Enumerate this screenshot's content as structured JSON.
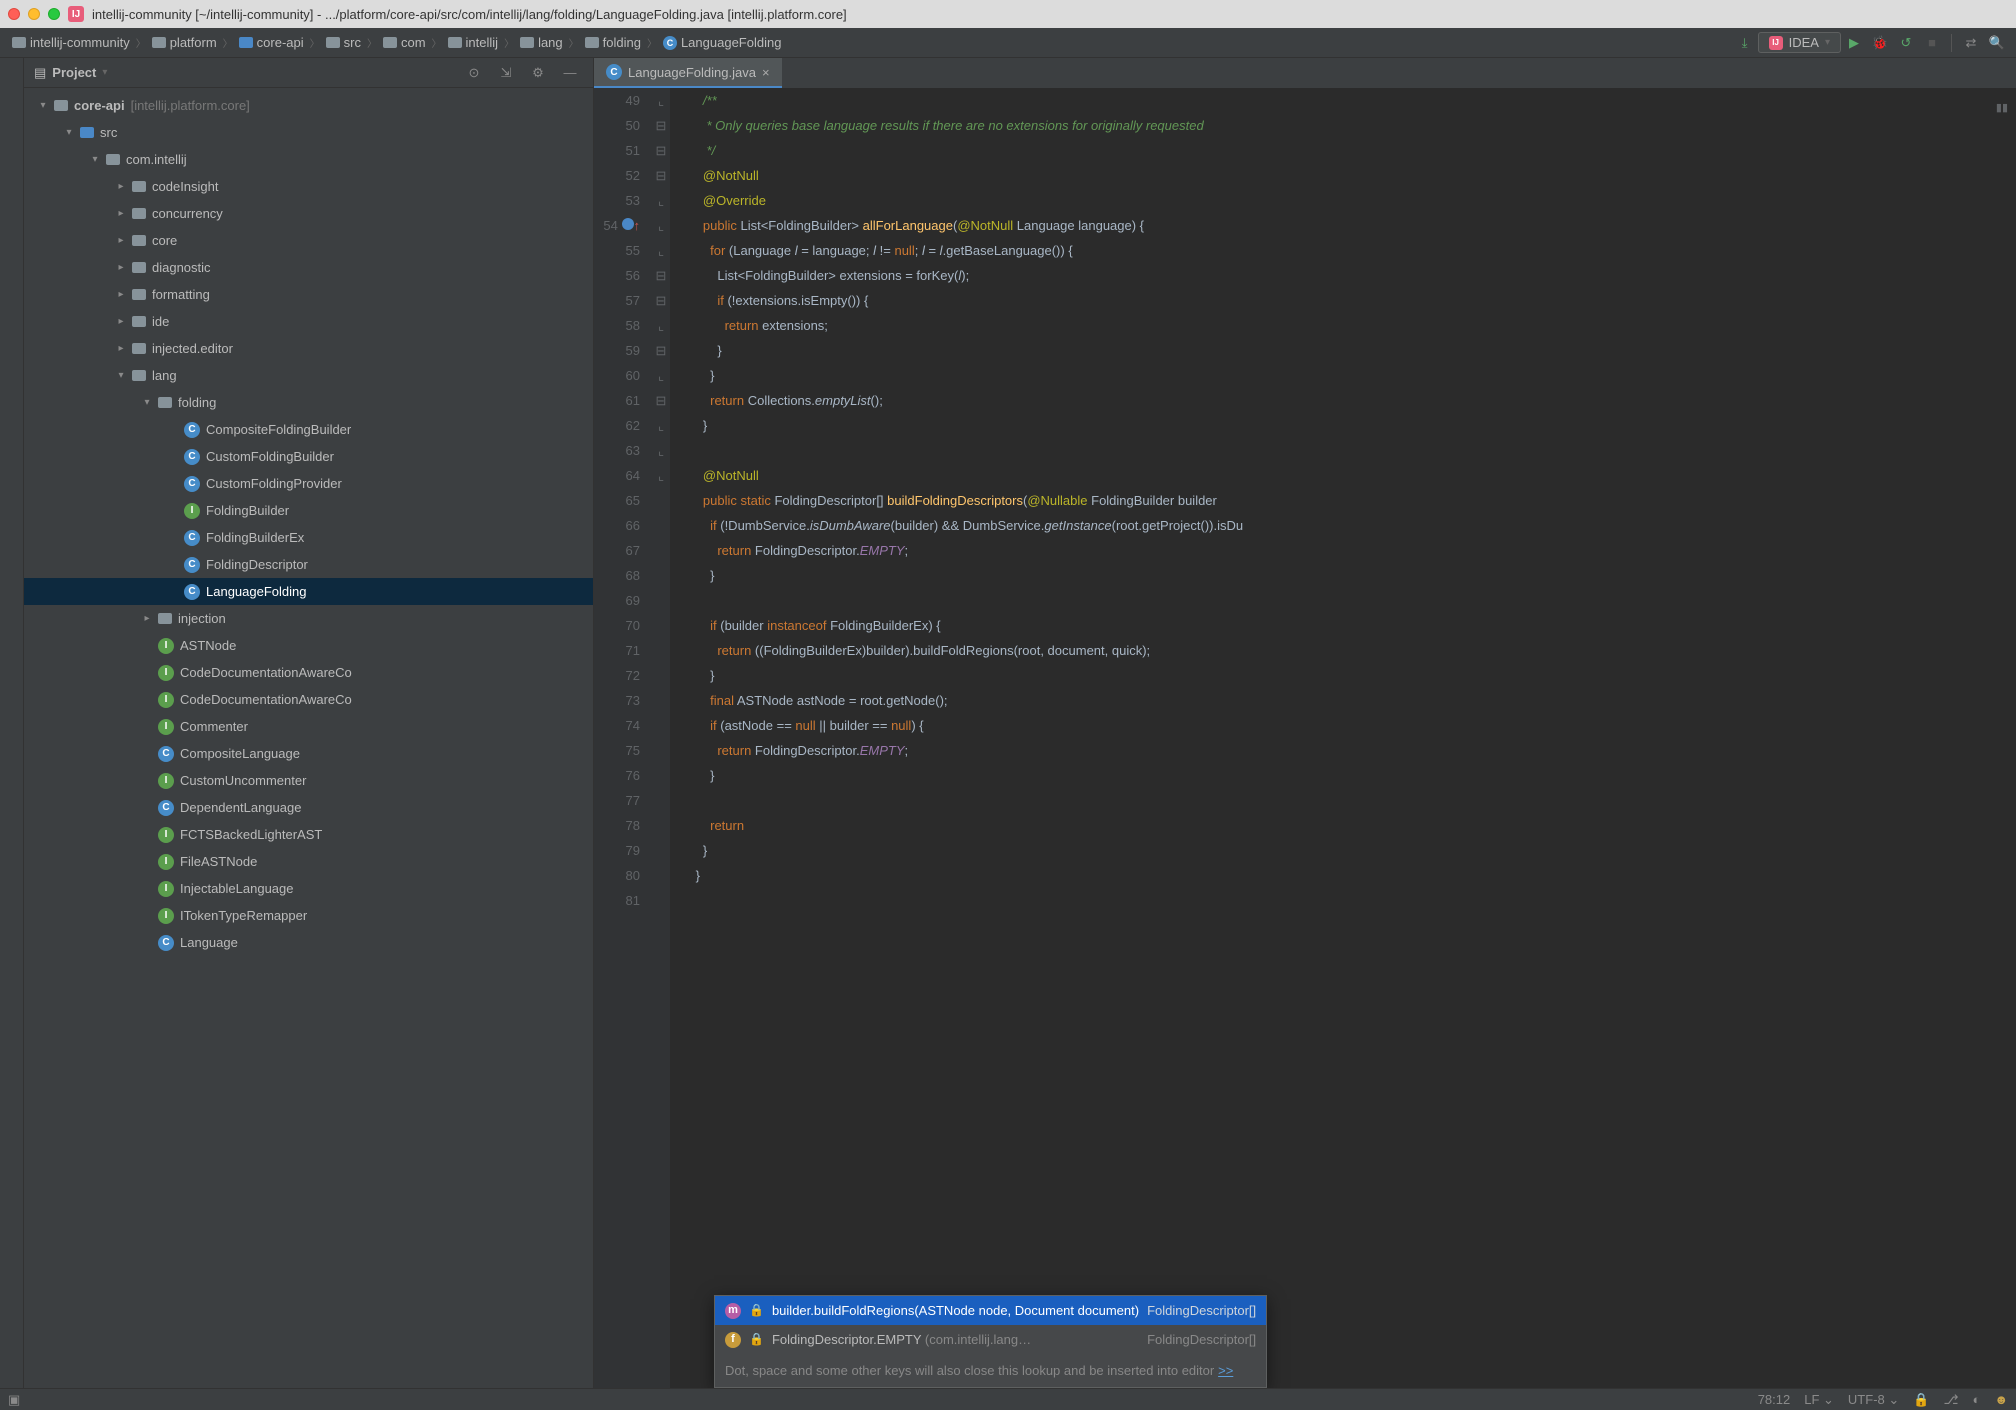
{
  "window": {
    "title": "intellij-community [~/intellij-community] - .../platform/core-api/src/com/intellij/lang/folding/LanguageFolding.java [intellij.platform.core]"
  },
  "breadcrumbs": [
    "intellij-community",
    "platform",
    "core-api",
    "src",
    "com",
    "intellij",
    "lang",
    "folding",
    "LanguageFolding"
  ],
  "run_config": "IDEA",
  "project": {
    "title": "Project",
    "tree": [
      {
        "d": 0,
        "a": "v",
        "i": "fold",
        "t": "core-api",
        "suffix": "[intellij.platform.core]",
        "bold": true
      },
      {
        "d": 1,
        "a": "v",
        "i": "fold-blue",
        "t": "src"
      },
      {
        "d": 2,
        "a": "v",
        "i": "fold",
        "t": "com.intellij"
      },
      {
        "d": 3,
        "a": ">",
        "i": "fold",
        "t": "codeInsight"
      },
      {
        "d": 3,
        "a": ">",
        "i": "fold",
        "t": "concurrency"
      },
      {
        "d": 3,
        "a": ">",
        "i": "fold",
        "t": "core"
      },
      {
        "d": 3,
        "a": ">",
        "i": "fold",
        "t": "diagnostic"
      },
      {
        "d": 3,
        "a": ">",
        "i": "fold",
        "t": "formatting"
      },
      {
        "d": 3,
        "a": ">",
        "i": "fold",
        "t": "ide"
      },
      {
        "d": 3,
        "a": ">",
        "i": "fold",
        "t": "injected.editor"
      },
      {
        "d": 3,
        "a": "v",
        "i": "fold",
        "t": "lang"
      },
      {
        "d": 4,
        "a": "v",
        "i": "fold",
        "t": "folding"
      },
      {
        "d": 5,
        "a": "",
        "i": "c",
        "t": "CompositeFoldingBuilder"
      },
      {
        "d": 5,
        "a": "",
        "i": "c",
        "t": "CustomFoldingBuilder"
      },
      {
        "d": 5,
        "a": "",
        "i": "c",
        "t": "CustomFoldingProvider"
      },
      {
        "d": 5,
        "a": "",
        "i": "i",
        "t": "FoldingBuilder"
      },
      {
        "d": 5,
        "a": "",
        "i": "c",
        "t": "FoldingBuilderEx"
      },
      {
        "d": 5,
        "a": "",
        "i": "c",
        "t": "FoldingDescriptor"
      },
      {
        "d": 5,
        "a": "",
        "i": "c",
        "t": "LanguageFolding",
        "sel": true
      },
      {
        "d": 4,
        "a": ">",
        "i": "fold",
        "t": "injection"
      },
      {
        "d": 4,
        "a": "",
        "i": "i",
        "t": "ASTNode"
      },
      {
        "d": 4,
        "a": "",
        "i": "i",
        "t": "CodeDocumentationAwareCo"
      },
      {
        "d": 4,
        "a": "",
        "i": "i",
        "t": "CodeDocumentationAwareCo"
      },
      {
        "d": 4,
        "a": "",
        "i": "i",
        "t": "Commenter"
      },
      {
        "d": 4,
        "a": "",
        "i": "c",
        "t": "CompositeLanguage"
      },
      {
        "d": 4,
        "a": "",
        "i": "i",
        "t": "CustomUncommenter"
      },
      {
        "d": 4,
        "a": "",
        "i": "c",
        "t": "DependentLanguage"
      },
      {
        "d": 4,
        "a": "",
        "i": "i",
        "t": "FCTSBackedLighterAST"
      },
      {
        "d": 4,
        "a": "",
        "i": "i",
        "t": "FileASTNode"
      },
      {
        "d": 4,
        "a": "",
        "i": "i",
        "t": "InjectableLanguage"
      },
      {
        "d": 4,
        "a": "",
        "i": "i",
        "t": "ITokenTypeRemapper"
      },
      {
        "d": 4,
        "a": "",
        "i": "c",
        "t": "Language"
      }
    ]
  },
  "tab": {
    "name": "LanguageFolding.java"
  },
  "lines_start": 49,
  "code": [
    {
      "n": 49,
      "f": "",
      "h": "        <span class='cmt'>/**</span>"
    },
    {
      "n": 50,
      "f": "",
      "h": "<span class='cmt'>         * Only queries base language results if there are no extensions for originally requested</span>"
    },
    {
      "n": 51,
      "f": "]",
      "h": "<span class='cmt'>         */</span>"
    },
    {
      "n": 52,
      "f": "",
      "h": "        <span class='ann'>@NotNull</span>"
    },
    {
      "n": 53,
      "f": "",
      "h": "        <span class='ann'>@Override</span>"
    },
    {
      "n": 54,
      "f": "[",
      "g": "o",
      "h": "        <span class='kw'>public</span> List&lt;FoldingBuilder&gt; <span class='fn'>allForLanguage</span>(<span class='ann'>@NotNull</span> Language <span class='par'>language</span>) {"
    },
    {
      "n": 55,
      "f": "[",
      "h": "          <span class='kw'>for</span> (Language <span class='l'>l</span> = language; <span class='l'>l</span> != <span class='kw'>null</span>; <span class='l'>l</span> = <span class='l'>l</span>.getBaseLanguage()) {"
    },
    {
      "n": 56,
      "f": "",
      "h": "            List&lt;FoldingBuilder&gt; extensions = forKey(<span class='l'>l</span>);"
    },
    {
      "n": 57,
      "f": "[",
      "h": "            <span class='kw'>if</span> (!extensions.isEmpty()) {"
    },
    {
      "n": 58,
      "f": "",
      "h": "              <span class='kw'>return</span> extensions;"
    },
    {
      "n": 59,
      "f": "]",
      "h": "            }"
    },
    {
      "n": 60,
      "f": "]",
      "h": "          }"
    },
    {
      "n": 61,
      "f": "",
      "h": "          <span class='kw'>return</span> Collections.<span class='it'>emptyList</span>();"
    },
    {
      "n": 62,
      "f": "]",
      "h": "        }"
    },
    {
      "n": 63,
      "f": "",
      "h": ""
    },
    {
      "n": 64,
      "f": "",
      "h": "        <span class='ann'>@NotNull</span>"
    },
    {
      "n": 65,
      "f": "[",
      "h": "        <span class='kw'>public static</span> FoldingDescriptor[] <span class='fn'>buildFoldingDescriptors</span>(<span class='ann'>@Nullable</span> FoldingBuilder <span class='par'>builder</span>"
    },
    {
      "n": 66,
      "f": "[",
      "h": "          <span class='kw'>if</span> (!DumbService.<span class='it'>isDumbAware</span>(builder) &amp;&amp; DumbService.<span class='it'>getInstance</span>(root.getProject()).isDu"
    },
    {
      "n": 67,
      "f": "",
      "h": "            <span class='kw'>return</span> FoldingDescriptor.<span class='it pur'>EMPTY</span>;"
    },
    {
      "n": 68,
      "f": "]",
      "h": "          }"
    },
    {
      "n": 69,
      "f": "",
      "h": ""
    },
    {
      "n": 70,
      "f": "[",
      "h": "          <span class='kw'>if</span> (builder <span class='kw'>instanceof</span> FoldingBuilderEx) {"
    },
    {
      "n": 71,
      "f": "",
      "h": "            <span class='kw'>return</span> ((FoldingBuilderEx)builder).buildFoldRegions(root, document, quick);"
    },
    {
      "n": 72,
      "f": "]",
      "h": "          }"
    },
    {
      "n": 73,
      "f": "",
      "h": "          <span class='kw'>final</span> ASTNode astNode = root.getNode();"
    },
    {
      "n": 74,
      "f": "[",
      "h": "          <span class='kw'>if</span> (astNode == <span class='kw'>null</span> || builder == <span class='kw'>null</span>) {"
    },
    {
      "n": 75,
      "f": "",
      "h": "            <span class='kw'>return</span> FoldingDescriptor.<span class='it pur'>EMPTY</span>;"
    },
    {
      "n": 76,
      "f": "]",
      "h": "          }"
    },
    {
      "n": 77,
      "f": "",
      "h": ""
    },
    {
      "n": 78,
      "f": "",
      "h": "          <span class='kw'>return</span> <span style='background:#323232'>&#8203;</span>"
    },
    {
      "n": 79,
      "f": "]",
      "h": "        }"
    },
    {
      "n": 80,
      "f": "]",
      "h": "      }"
    },
    {
      "n": 81,
      "f": "",
      "h": ""
    }
  ],
  "completion": {
    "items": [
      {
        "icon": "m",
        "label": "builder.buildFoldRegions(ASTNode node, Document document)",
        "type": "FoldingDescriptor[]",
        "sel": true
      },
      {
        "icon": "f",
        "label": "FoldingDescriptor.EMPTY",
        "tail": "(com.intellij.lang…",
        "type": "FoldingDescriptor[]"
      }
    ],
    "hint": "Dot, space and some other keys will also close this lookup and be inserted into editor",
    "hint_link": ">>"
  },
  "status": {
    "pos": "78:12",
    "eol": "LF",
    "enc": "UTF-8"
  }
}
